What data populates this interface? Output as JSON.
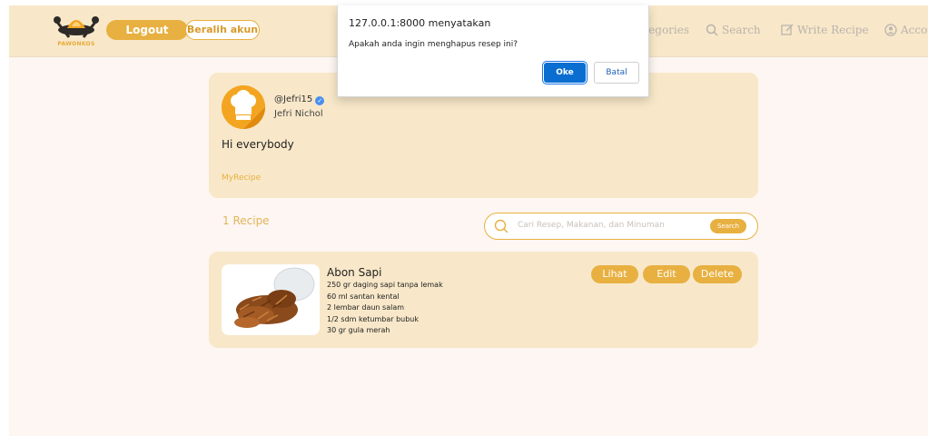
{
  "navbar": {
    "logo_text": "PAWONKOS",
    "logout_label": "Logout",
    "switch_account_label": "Beralih akun",
    "categories_label": "Categories",
    "search_label": "Search",
    "write_recipe_label": "Write Recipe",
    "account_label": "Account"
  },
  "profile": {
    "username": "@Jefri15",
    "full_name": "Jefri Nichol",
    "bio": "Hi everybody",
    "my_recipe_label": "MyRecipe"
  },
  "recipe_list": {
    "count_label": "1 Recipe",
    "search_placeholder": "Cari Resep, Makanan, dan Minuman",
    "search_button_label": "Search"
  },
  "recipes": [
    {
      "title": "Abon Sapi",
      "ingredients": [
        "250 gr daging sapi tanpa lemak",
        "60 ml santan kental",
        "2 lembar daun salam",
        "1/2 sdm ketumbar bubuk",
        "30 gr gula merah"
      ],
      "view_label": "Lihat",
      "edit_label": "Edit",
      "delete_label": "Delete"
    }
  ],
  "dialog": {
    "title": "127.0.0.1:8000 menyatakan",
    "message": "Apakah anda ingin menghapus resep ini?",
    "ok_label": "Oke",
    "cancel_label": "Batal"
  },
  "colors": {
    "accent": "#e8b040",
    "navbar_bg": "#f8e8c9",
    "page_bg": "#fdf6f2",
    "dialog_primary": "#0a6ed1"
  }
}
